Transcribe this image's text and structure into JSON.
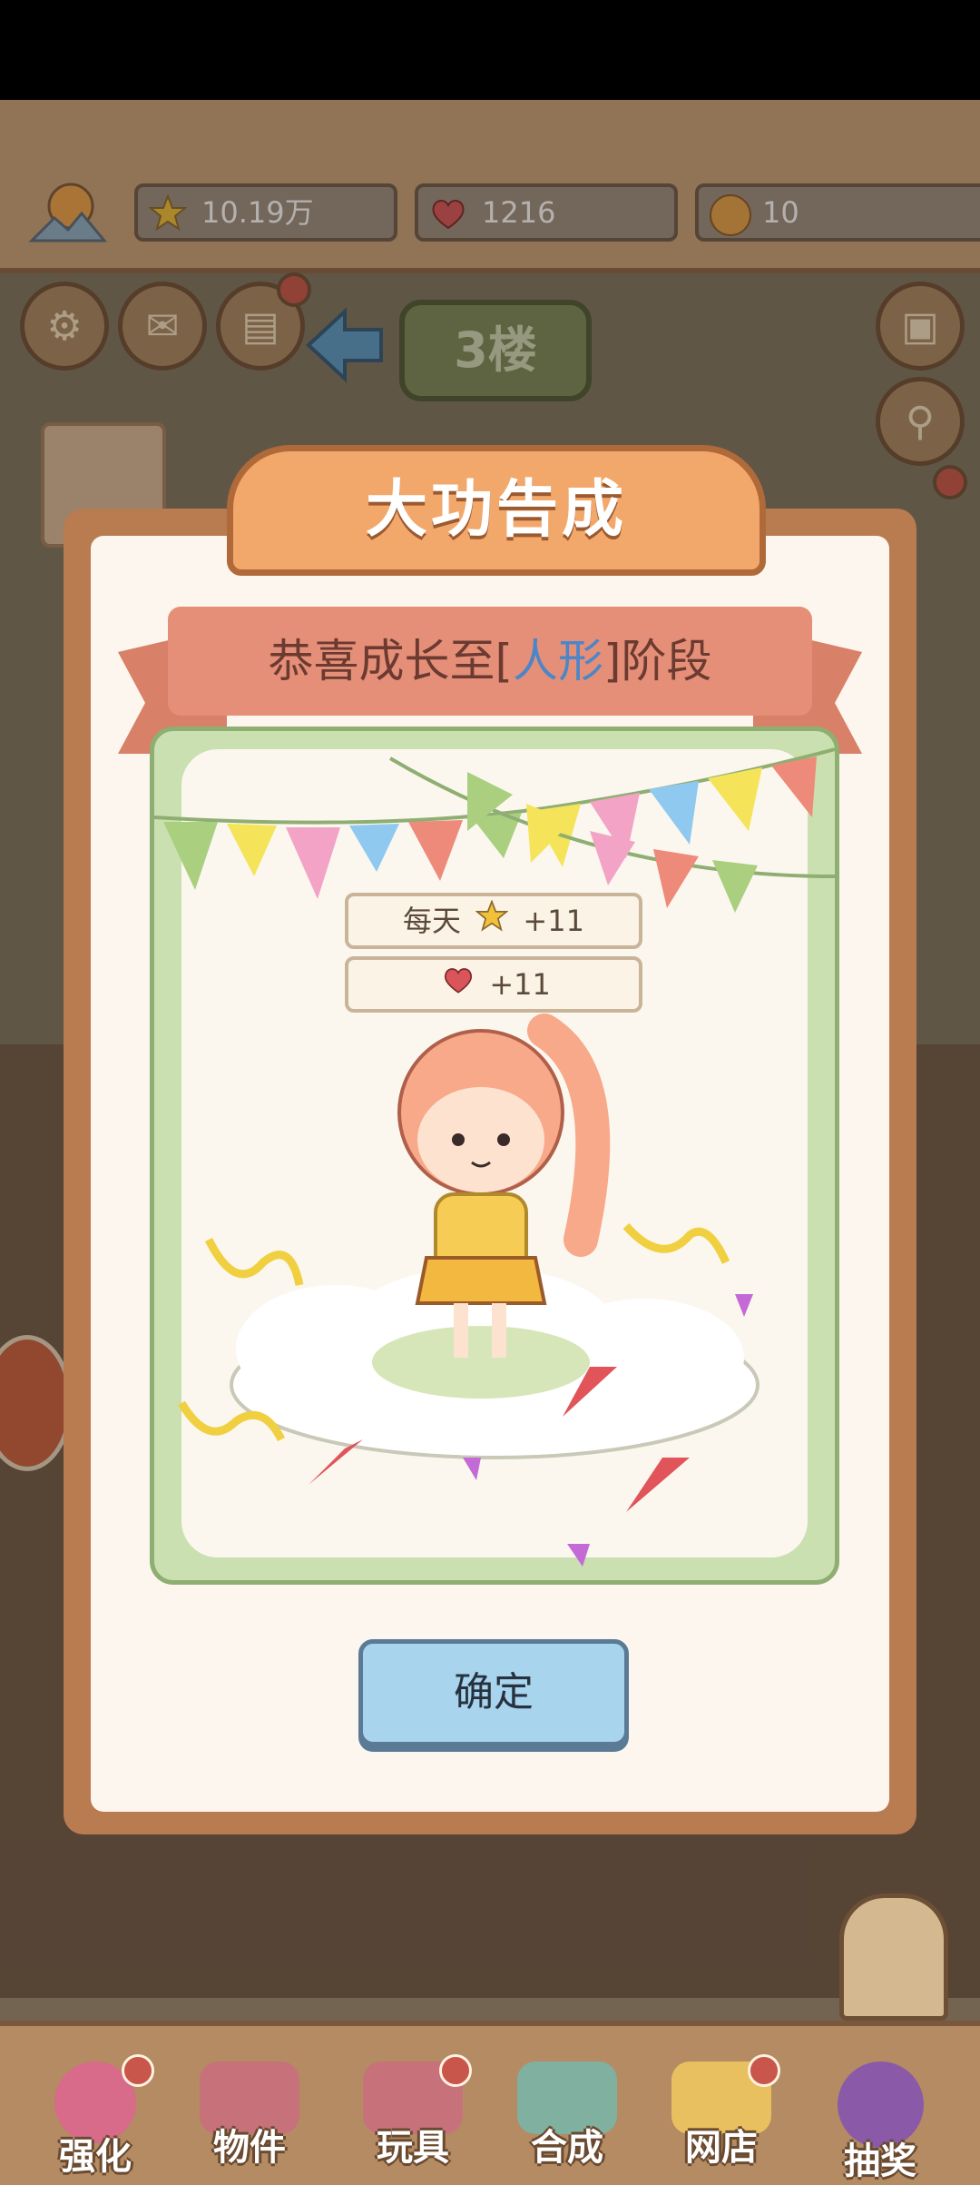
{
  "resources": {
    "stars": "10.19万",
    "hearts": "1216",
    "coins": "10"
  },
  "floor_label": "3楼",
  "dialog": {
    "title": "大功告成",
    "message_prefix": "恭喜成长至[",
    "message_highlight": "人形",
    "message_suffix": "]阶段",
    "rewards": [
      {
        "prefix": "每天",
        "icon": "star-icon",
        "value": "+11"
      },
      {
        "prefix": "",
        "icon": "heart-icon",
        "value": "+11"
      }
    ],
    "confirm_label": "确定"
  },
  "tabs": [
    {
      "label": "强化",
      "badge": true
    },
    {
      "label": "物件",
      "badge": false
    },
    {
      "label": "玩具",
      "badge": true
    },
    {
      "label": "合成",
      "badge": false
    },
    {
      "label": "网店",
      "badge": true
    },
    {
      "label": "抽奖",
      "badge": false
    }
  ],
  "colors": {
    "accent_orange": "#f3a86b",
    "ribbon": "#e58f78",
    "highlight_blue": "#4c86c8",
    "button_blue": "#a8d4ee"
  }
}
